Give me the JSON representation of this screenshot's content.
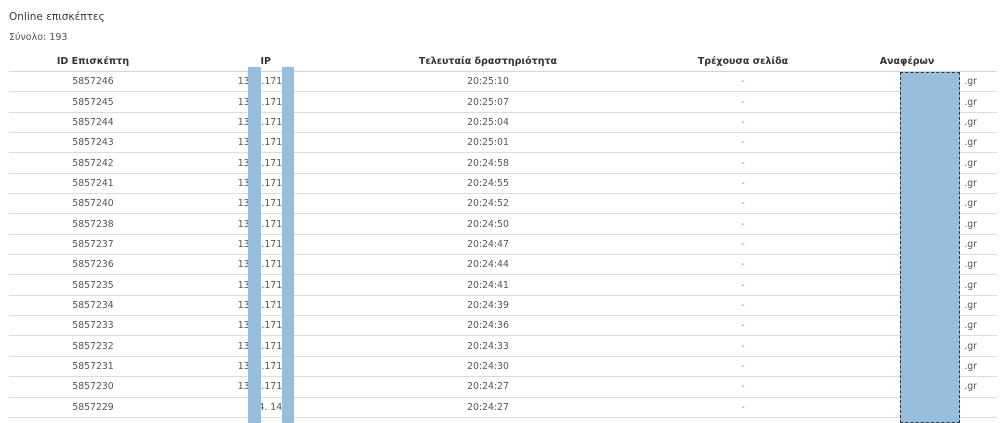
{
  "header": {
    "title": "Online επισκέπτες",
    "total": "Σύνολο: 193"
  },
  "columns": {
    "id": "ID Επισκέπτη",
    "ip": "IP",
    "last_activity": "Τελευταία δραστηριότητα",
    "current_page": "Τρέχουσα σελίδα",
    "referrer": "Αναφέρων"
  },
  "rows": [
    {
      "id": "5857246",
      "ip": "135.   .171   1",
      "time": "20:25:10",
      "page": "-",
      "ref": ".gr"
    },
    {
      "id": "5857245",
      "ip": "135.   .171   1",
      "time": "20:25:07",
      "page": "-",
      "ref": ".gr"
    },
    {
      "id": "5857244",
      "ip": "135.   .171   1",
      "time": "20:25:04",
      "page": "-",
      "ref": ".gr"
    },
    {
      "id": "5857243",
      "ip": "135.   .171   1",
      "time": "20:25:01",
      "page": "-",
      "ref": ".gr"
    },
    {
      "id": "5857242",
      "ip": "135.   .171   1",
      "time": "20:24:58",
      "page": "-",
      "ref": ".gr"
    },
    {
      "id": "5857241",
      "ip": "135.   .171   1",
      "time": "20:24:55",
      "page": "-",
      "ref": ".gr"
    },
    {
      "id": "5857240",
      "ip": "135.   .171   1",
      "time": "20:24:52",
      "page": "-",
      "ref": ".gr"
    },
    {
      "id": "5857238",
      "ip": "135.   .171   1",
      "time": "20:24:50",
      "page": "-",
      "ref": ".gr"
    },
    {
      "id": "5857237",
      "ip": "135.   .171   1",
      "time": "20:24:47",
      "page": "-",
      "ref": ".gr"
    },
    {
      "id": "5857236",
      "ip": "135.   .171   1",
      "time": "20:24:44",
      "page": "-",
      "ref": ".gr"
    },
    {
      "id": "5857235",
      "ip": "135.   .171   1",
      "time": "20:24:41",
      "page": "-",
      "ref": ".gr"
    },
    {
      "id": "5857234",
      "ip": "135.   .171   1",
      "time": "20:24:39",
      "page": "-",
      "ref": ".gr"
    },
    {
      "id": "5857233",
      "ip": "135.   .171   1",
      "time": "20:24:36",
      "page": "-",
      "ref": ".gr"
    },
    {
      "id": "5857232",
      "ip": "135.   .171   1",
      "time": "20:24:33",
      "page": "-",
      "ref": ".gr"
    },
    {
      "id": "5857231",
      "ip": "135.   .171   1",
      "time": "20:24:30",
      "page": "-",
      "ref": ".gr"
    },
    {
      "id": "5857230",
      "ip": "135.   .171   1",
      "time": "20:24:27",
      "page": "-",
      "ref": ".gr"
    },
    {
      "id": "5857229",
      "ip": "54.   148.",
      "time": "20:24:27",
      "page": "-",
      "ref": ""
    }
  ],
  "colors": {
    "redaction": "#97bfdd",
    "row_border": "#d8dde2"
  }
}
